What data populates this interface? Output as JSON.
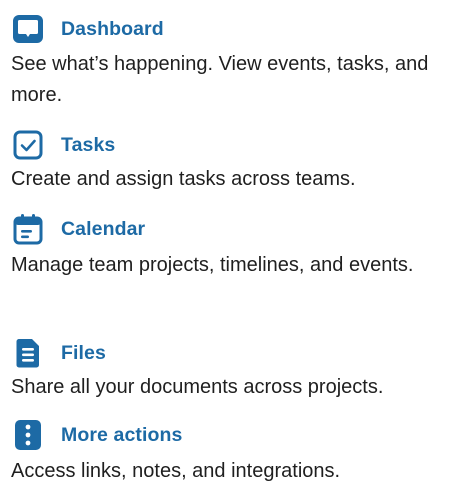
{
  "accent_color": "#1d6aa5",
  "text_color": "#1f1f1f",
  "items": [
    {
      "icon": "dashboard-icon",
      "title": "Dashboard",
      "description": "See what’s happening. View events, tasks, and more."
    },
    {
      "icon": "tasks-checkbox-icon",
      "title": "Tasks",
      "description": "Create and assign tasks across teams."
    },
    {
      "icon": "calendar-icon",
      "title": "Calendar",
      "description": "Manage team projects, timelines, and events."
    },
    {
      "icon": "file-icon",
      "title": "Files",
      "description": "Share all your documents across projects."
    },
    {
      "icon": "more-vertical-icon",
      "title": "More actions",
      "description": "Access links, notes, and integrations."
    }
  ]
}
